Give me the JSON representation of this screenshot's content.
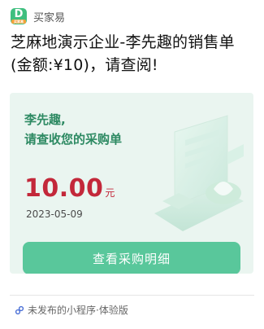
{
  "app": {
    "name": "买家易",
    "logo_tag": "买家易"
  },
  "message": {
    "title": "芝麻地演示企业-李先趣的销售单(金额:¥10)，请查阅!"
  },
  "card": {
    "buyer_line": "李先趣,",
    "headline": "请查收您的采购单",
    "amount": "10.00",
    "amount_unit": "元",
    "date": "2023-05-09",
    "button_label": "查看采购明细"
  },
  "footer": {
    "text": "未发布的小程序·体验版",
    "icon": "miniprogram-link-icon"
  },
  "colors": {
    "brand_green": "#3fbf7f",
    "card_bg": "#eaf5f0",
    "button_green": "#59c79b",
    "amount_red": "#c3283a",
    "text_green": "#2e8a63"
  }
}
